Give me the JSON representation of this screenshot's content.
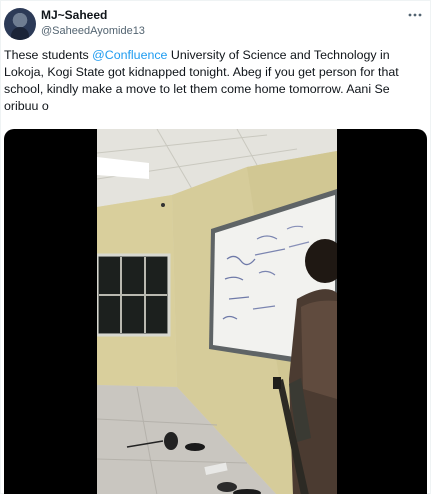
{
  "author": {
    "display_name": "MJ~Saheed",
    "handle": "@SaheedAyomide13",
    "avatar_icon": "profile-avatar"
  },
  "menu": {
    "icon": "more-horizontal-icon"
  },
  "tweet": {
    "text_before": "These students ",
    "mention": "@Confluence",
    "text_after": " University of Science and Technology in Lokoja, Kogi State got kidnapped tonight. Abeg if you get person for that school, kindly make a move to let them come home tomorrow. Aani Se oribuu o"
  },
  "media": {
    "type": "video",
    "background": "#000000",
    "scene_description_icon": "classroom-video-frame"
  },
  "colors": {
    "mention": "#1d9bf0",
    "text": "#0f1419",
    "secondary": "#536471"
  }
}
